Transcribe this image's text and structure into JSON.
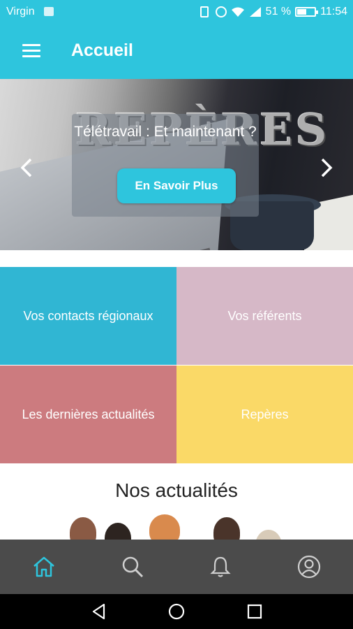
{
  "status_bar": {
    "carrier": "Virgin",
    "battery": "51 %",
    "time": "11:54",
    "icons": [
      "sim-icon",
      "vibrate-icon",
      "alarm-icon",
      "wifi-icon",
      "signal-icon",
      "battery-icon"
    ],
    "battery_level": 0.51
  },
  "app_bar": {
    "title": "Accueil",
    "menu_icon": "menu-icon"
  },
  "carousel": {
    "brand_text": "REPÈRES",
    "caption": "Télétravail : Et maintenant ?",
    "button_label": "En Savoir Plus",
    "prev_icon": "chevron-left-icon",
    "next_icon": "chevron-right-icon"
  },
  "tiles": [
    {
      "label": "Vos contacts régionaux",
      "color": "#30b6d3"
    },
    {
      "label": "Vos référents",
      "color": "#d6b8c7"
    },
    {
      "label": "Les dernières actualités",
      "color": "#cc7b7f"
    },
    {
      "label": "Repères",
      "color": "#fad967"
    }
  ],
  "news": {
    "title": "Nos actualités"
  },
  "bottom_nav": {
    "items": [
      {
        "icon": "home-icon",
        "active": true
      },
      {
        "icon": "search-icon",
        "active": false
      },
      {
        "icon": "bell-icon",
        "active": false
      },
      {
        "icon": "user-icon",
        "active": false
      }
    ],
    "active_color": "#2ec5dd",
    "inactive_color": "#cfcfcf"
  },
  "colors": {
    "primary": "#2ec5dd",
    "nav_background": "#4b4b4b"
  }
}
